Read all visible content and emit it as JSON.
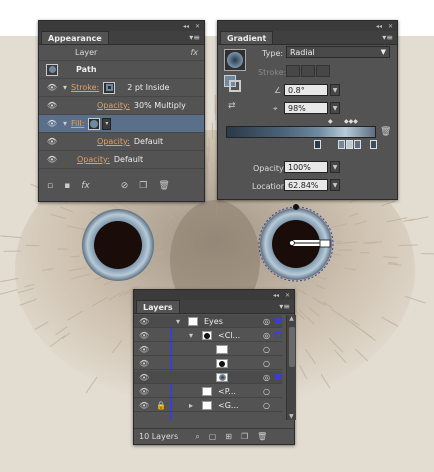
{
  "appearance": {
    "tab": "Appearance",
    "target": "Layer",
    "path_label": "Path",
    "stroke_label": "Stroke:",
    "stroke_value": "2 pt  Inside",
    "stroke_opacity_label": "Opacity:",
    "stroke_opacity_value": "30% Multiply",
    "fill_label": "Fill:",
    "fill_opacity_label": "Opacity:",
    "fill_opacity_value": "Default",
    "opacity_label": "Opacity:",
    "opacity_value": "Default",
    "fx_label": "fx"
  },
  "gradient": {
    "tab": "Gradient",
    "type_label": "Type:",
    "type_value": "Radial",
    "stroke_label": "Stroke:",
    "angle_value": "0.8°",
    "aspect_value": "98%",
    "opacity_label": "Opacity:",
    "opacity_value": "100%",
    "location_label": "Location:",
    "location_value": "62.84%"
  },
  "layers": {
    "tab": "Layers",
    "rows": [
      {
        "name": "Eyes"
      },
      {
        "name": "<Cl..."
      },
      {
        "name": ""
      },
      {
        "name": ""
      },
      {
        "name": ""
      },
      {
        "name": "<P..."
      },
      {
        "name": "<G..."
      }
    ],
    "count": "10 Layers"
  },
  "colors": {
    "panel_bg": "#535353",
    "selected_row": "#5a6f8a",
    "accent_orange": "#e4a060",
    "canvas_bg": "#e3dcd0"
  }
}
